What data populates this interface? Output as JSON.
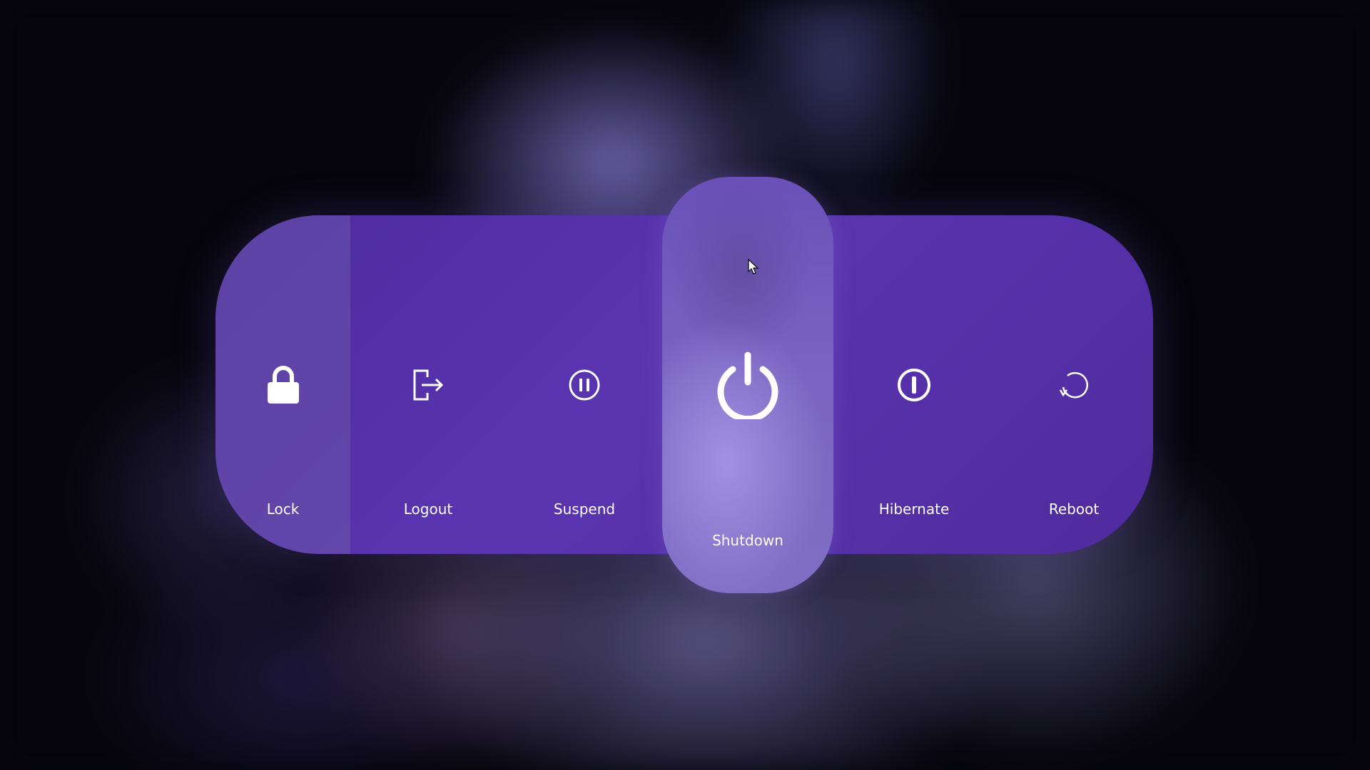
{
  "power_menu": {
    "buttons": [
      {
        "id": "lock",
        "label": "Lock",
        "icon": "lock-icon"
      },
      {
        "id": "logout",
        "label": "Logout",
        "icon": "logout-icon"
      },
      {
        "id": "suspend",
        "label": "Suspend",
        "icon": "pause-circle-icon"
      },
      {
        "id": "shutdown",
        "label": "Shutdown",
        "icon": "power-icon"
      },
      {
        "id": "hibernate",
        "label": "Hibernate",
        "icon": "hibernate-icon"
      },
      {
        "id": "reboot",
        "label": "Reboot",
        "icon": "reboot-icon"
      }
    ],
    "selected": "shutdown",
    "colors": {
      "accent": "#5633a8",
      "selected": "#7b67c3",
      "text": "#ffffff"
    }
  }
}
